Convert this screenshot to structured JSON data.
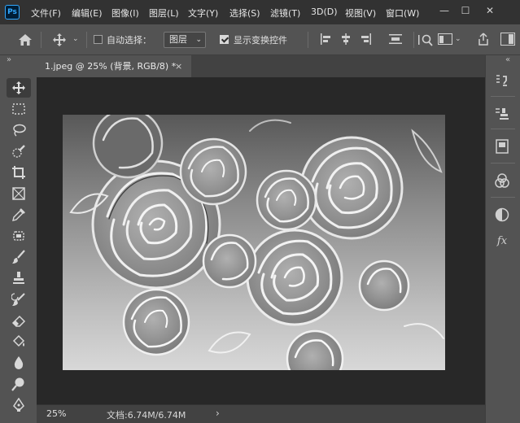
{
  "app": {
    "logo_text": "Ps"
  },
  "menu": [
    "文件(F)",
    "编辑(E)",
    "图像(I)",
    "图层(L)",
    "文字(Y)",
    "选择(S)",
    "滤镜(T)",
    "3D(D)",
    "视图(V)",
    "窗口(W)"
  ],
  "window_controls": {
    "minimize": "—",
    "restore": "☐",
    "close": "✕"
  },
  "options": {
    "auto_select_label": "自动选择：",
    "auto_select_checked": false,
    "auto_select_target": "图层",
    "show_transform_label": "显示变换控件",
    "show_transform_checked": true
  },
  "document": {
    "tab_title": "1.jpeg @ 25% (背景, RGB/8) *",
    "tab_close": "×",
    "zoom": "25%",
    "doc_info": "文档:6.74M/6.74M",
    "status_arrow": "›"
  },
  "toolbar": {
    "collapse": "»",
    "tools": [
      "move-tool",
      "marquee-tool",
      "lasso-tool",
      "quick-selection-tool",
      "crop-tool",
      "frame-tool",
      "eyedropper-tool",
      "patch-tool",
      "brush-tool",
      "clone-stamp-tool",
      "history-brush-tool",
      "eraser-tool",
      "paint-bucket-tool",
      "blur-tool",
      "dodge-tool",
      "pen-tool"
    ]
  },
  "right_panel": {
    "collapse": "«",
    "fx_label": "fx"
  },
  "colors": {
    "menubar": "#323232",
    "panel": "#535353",
    "canvas_bg": "#282828",
    "accent": "#31a8ff"
  }
}
